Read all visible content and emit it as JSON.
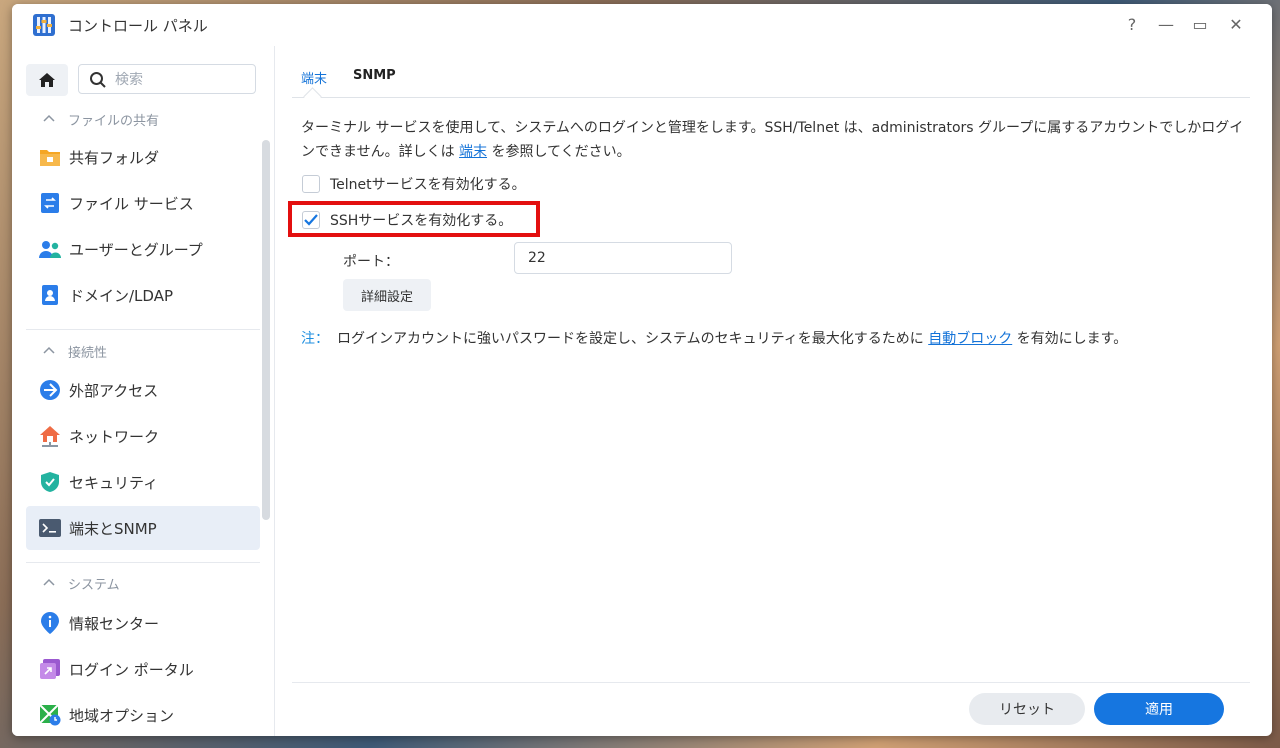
{
  "window": {
    "title": "コントロール パネル",
    "controls": {
      "help": "?",
      "minimize": "—",
      "maximize": "▭",
      "close": "✕"
    }
  },
  "sidebar": {
    "search_placeholder": "検索",
    "sections": [
      {
        "title": "ファイルの共有",
        "items": [
          {
            "label": "共有フォルダ",
            "icon": "folder-icon"
          },
          {
            "label": "ファイル サービス",
            "icon": "file-services-icon"
          },
          {
            "label": "ユーザーとグループ",
            "icon": "users-icon"
          },
          {
            "label": "ドメイン/LDAP",
            "icon": "domain-icon"
          }
        ]
      },
      {
        "title": "接続性",
        "items": [
          {
            "label": "外部アクセス",
            "icon": "external-access-icon"
          },
          {
            "label": "ネットワーク",
            "icon": "network-icon"
          },
          {
            "label": "セキュリティ",
            "icon": "shield-icon"
          },
          {
            "label": "端末とSNMP",
            "icon": "terminal-icon",
            "active": true
          }
        ]
      },
      {
        "title": "システム",
        "items": [
          {
            "label": "情報センター",
            "icon": "info-icon"
          },
          {
            "label": "ログイン ポータル",
            "icon": "login-portal-icon"
          },
          {
            "label": "地域オプション",
            "icon": "regional-options-icon"
          }
        ]
      }
    ]
  },
  "main": {
    "tabs": [
      {
        "label": "端末",
        "active": true
      },
      {
        "label": "SNMP",
        "active": false
      }
    ],
    "description_before": "ターミナル サービスを使用して、システムへのログインと管理をします。SSH/Telnet は、administrators グループに属するアカウントでしかログインできません。詳しくは ",
    "description_link": "端末",
    "description_after": " を参照してください。",
    "telnet": {
      "label": "Telnetサービスを有効化する。",
      "checked": false
    },
    "ssh": {
      "label": "SSHサービスを有効化する。",
      "checked": true
    },
    "port_label": "ポート：",
    "port_value": "22",
    "advanced_button": "詳細設定",
    "note_label": "注：",
    "note_before": "ログインアカウントに強いパスワードを設定し、システムのセキュリティを最大化するために ",
    "note_link": "自動ブロック",
    "note_after": " を有効にします。",
    "reset_button": "リセット",
    "apply_button": "適用"
  },
  "colors": {
    "accent": "#1676e0",
    "link": "#1473d8",
    "highlight_box": "#e30f0f",
    "active_nav_bg": "#e8eef7"
  }
}
